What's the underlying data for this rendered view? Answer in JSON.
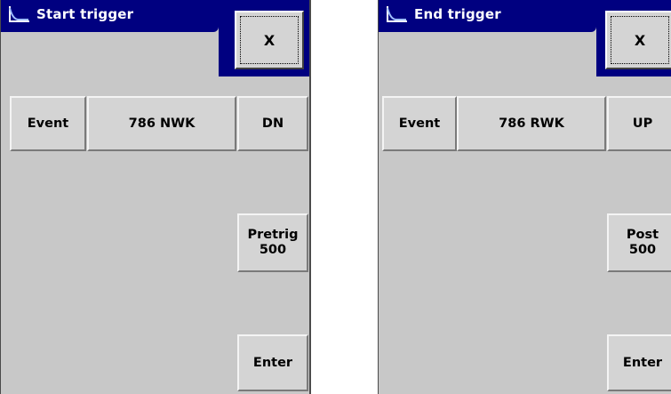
{
  "panels": [
    {
      "title": "Start trigger",
      "close_label": "X",
      "event_label": "Event",
      "channel_label": "786 NWK",
      "direction_label": "DN",
      "side_label": "Pretrig\n500",
      "enter_label": "Enter"
    },
    {
      "title": "End trigger",
      "close_label": "X",
      "event_label": "Event",
      "channel_label": "786 RWK",
      "direction_label": "UP",
      "side_label": "Post\n500",
      "enter_label": "Enter"
    }
  ],
  "colors": {
    "titlebar": "#000080",
    "panel": "#c8c8c8",
    "button": "#d4d4d4"
  },
  "icons": [
    "trigger-curve-icon"
  ]
}
